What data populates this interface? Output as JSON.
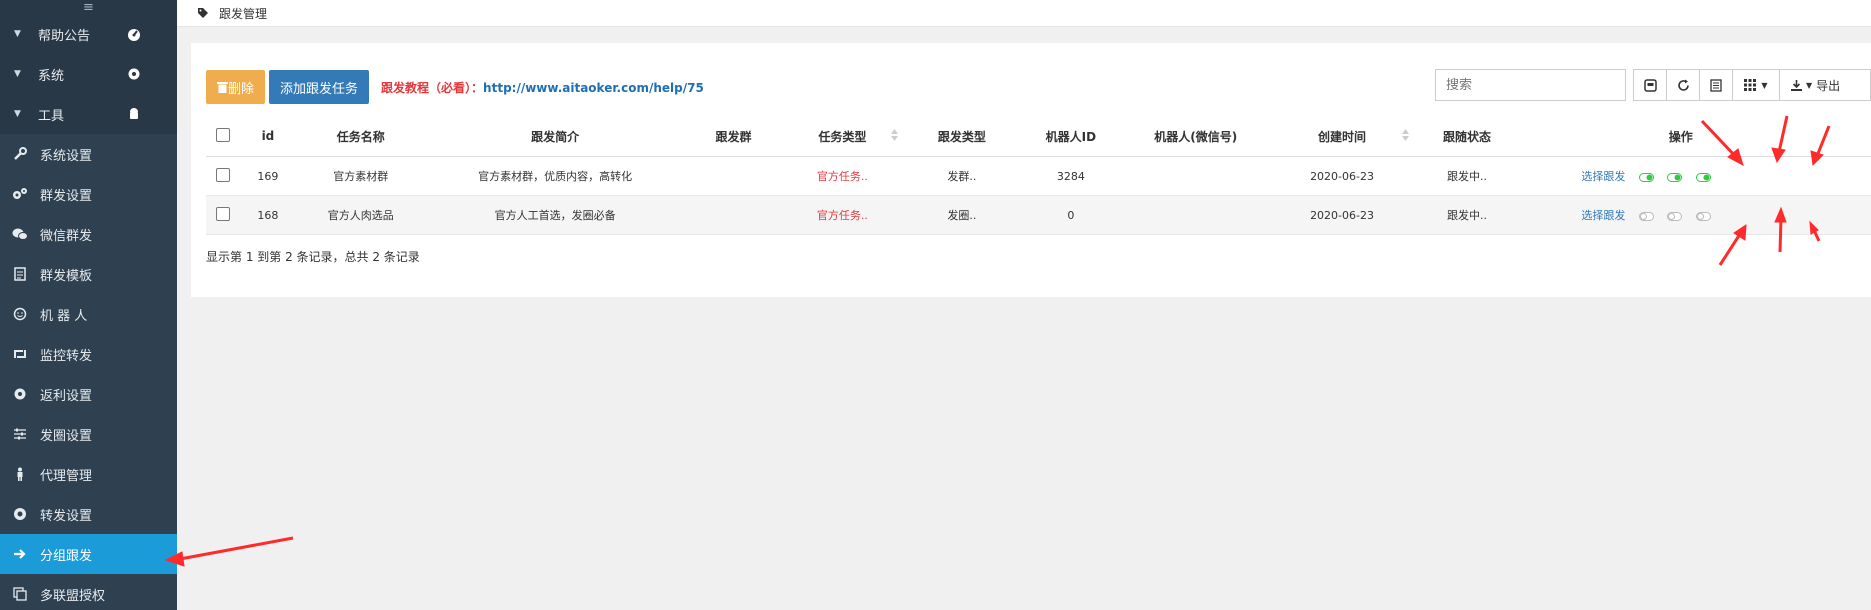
{
  "sidebar": {
    "toggle_icon": "hamburger-icon",
    "top_items": [
      {
        "label": "帮助公告",
        "icon": "dashboard-icon"
      },
      {
        "label": "系统",
        "icon": "gear-icon"
      },
      {
        "label": "工具",
        "icon": "android-icon"
      }
    ],
    "items": [
      {
        "label": "系统设置",
        "icon": "wrench-icon"
      },
      {
        "label": "群发设置",
        "icon": "cogs-icon"
      },
      {
        "label": "微信群发",
        "icon": "wechat-icon"
      },
      {
        "label": "群发模板",
        "icon": "document-icon"
      },
      {
        "label": "机 器 人",
        "icon": "smile-icon"
      },
      {
        "label": "监控转发",
        "icon": "retweet-icon"
      },
      {
        "label": "返利设置",
        "icon": "gear-icon"
      },
      {
        "label": "发圈设置",
        "icon": "sliders-icon"
      },
      {
        "label": "代理管理",
        "icon": "person-icon"
      },
      {
        "label": "转发设置",
        "icon": "eye-icon"
      },
      {
        "label": "分组跟发",
        "icon": "arrow-right-icon",
        "active": true
      },
      {
        "label": "多联盟授权",
        "icon": "copy-icon"
      }
    ]
  },
  "header": {
    "breadcrumb": "跟发管理",
    "icon": "tag-icon"
  },
  "toolbar": {
    "delete_label": "删除",
    "add_label": "添加跟发任务",
    "tutorial_label": "跟发教程（必看）：",
    "tutorial_url": "http://www.aitaoker.com/help/75",
    "search_placeholder": "搜索",
    "export_label": "导出"
  },
  "table": {
    "columns": [
      "id",
      "任务名称",
      "跟发简介",
      "跟发群",
      "任务类型",
      "跟发类型",
      "机器人ID",
      "机器人(微信号)",
      "创建时间",
      "跟随状态",
      "操作"
    ],
    "rows": [
      {
        "id": "169",
        "name": "官方素材群",
        "intro": "官方素材群，优质内容，高转化",
        "group": "",
        "task_type": "官方任务..",
        "follow_type": "发群..",
        "robot_id": "3284",
        "robot_wx": "",
        "created": "2020-06-23",
        "status": "跟发中..",
        "action": "选择跟发",
        "switches": [
          "on",
          "on",
          "on"
        ]
      },
      {
        "id": "168",
        "name": "官方人肉选品",
        "intro": "官方人工首选，发圈必备",
        "group": "",
        "task_type": "官方任务..",
        "follow_type": "发圈..",
        "robot_id": "0",
        "robot_wx": "",
        "created": "2020-06-23",
        "status": "跟发中..",
        "action": "选择跟发",
        "switches": [
          "off",
          "off",
          "off"
        ]
      }
    ],
    "summary": "显示第 1 到第 2 条记录，总共 2 条记录"
  },
  "colors": {
    "sidebar_bg": "#2f4050",
    "active": "#1b9bd7",
    "primary": "#337ab7",
    "warning": "#f0ad4e",
    "danger": "#e4393c",
    "switch_on": "#2ecc40",
    "annotation": "#ff2a2a"
  }
}
